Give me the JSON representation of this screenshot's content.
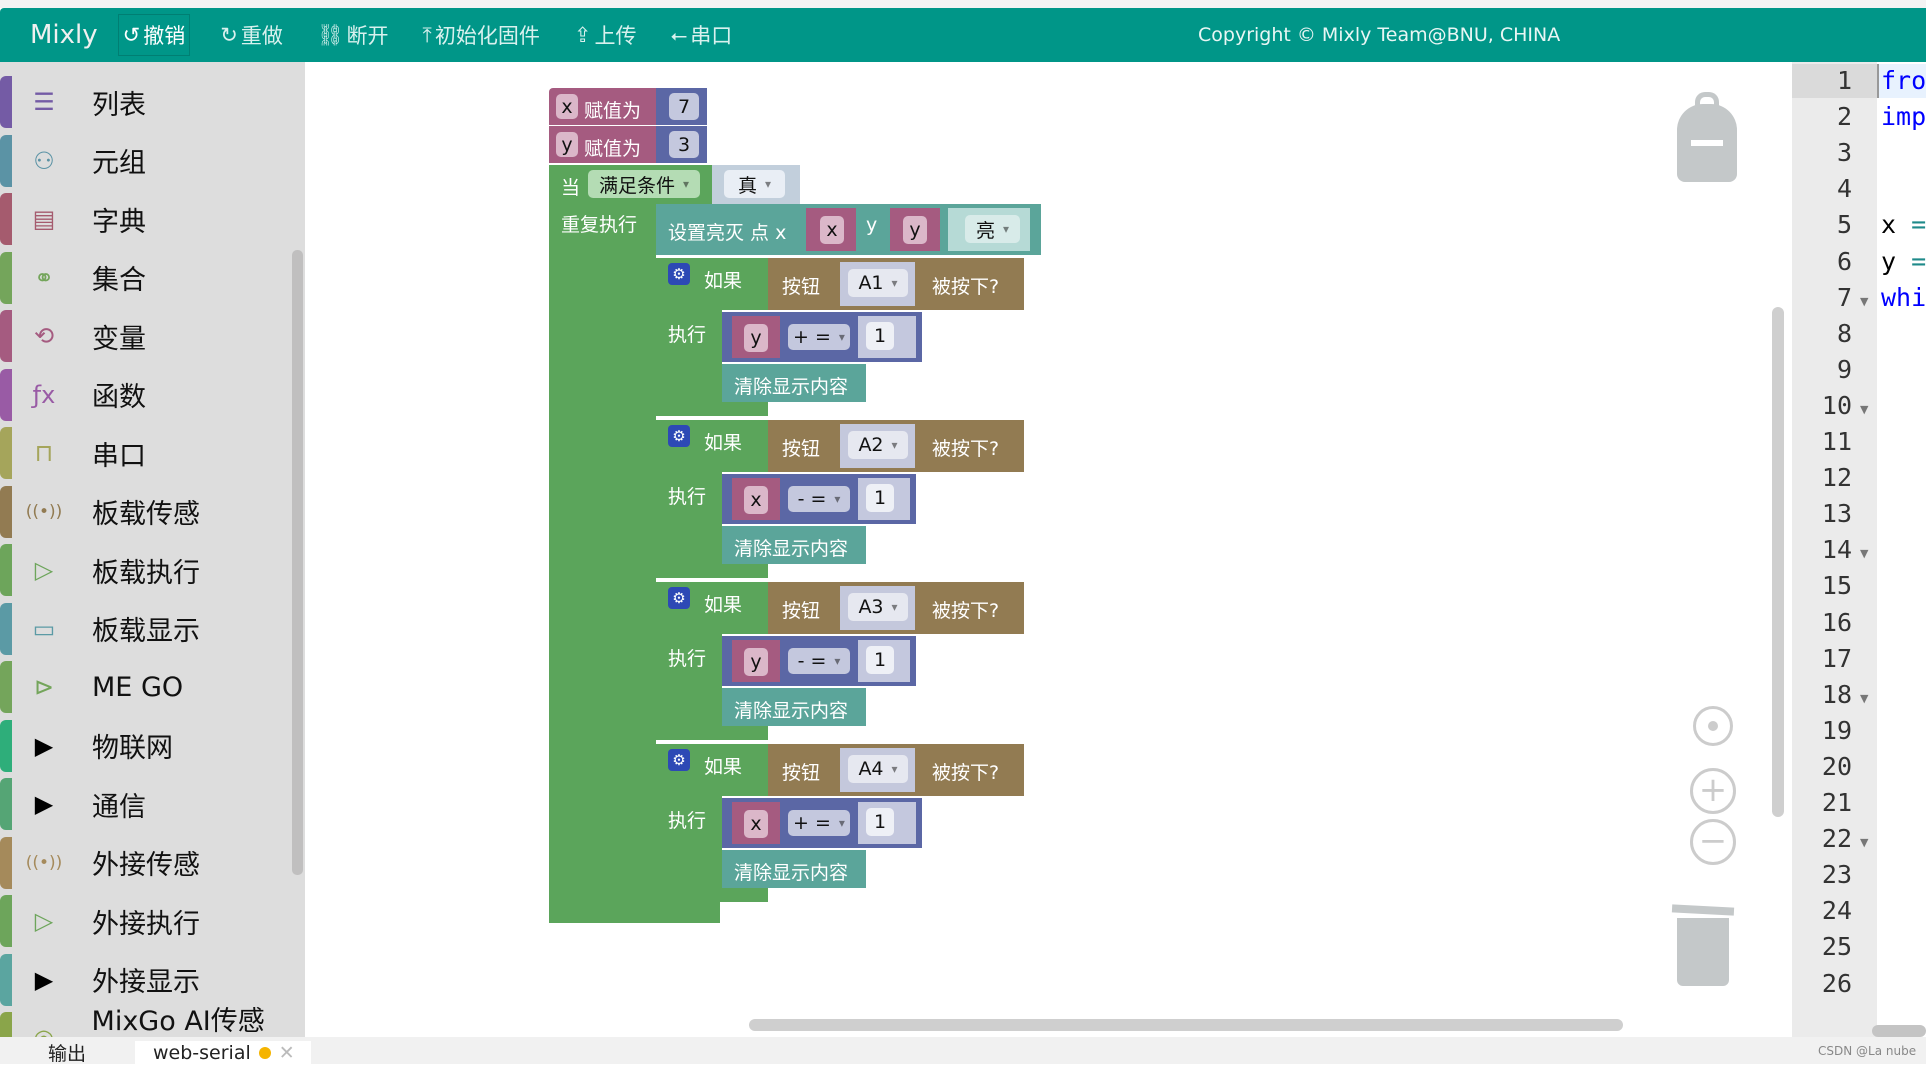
{
  "header": {
    "logo": "Mixly",
    "buttons": [
      {
        "label": "撤销",
        "icon": "undo-icon"
      },
      {
        "label": "重做",
        "icon": "redo-icon"
      },
      {
        "label": "断开",
        "icon": "unlink-icon"
      },
      {
        "label": "初始化固件",
        "icon": "upload-firmware-icon"
      },
      {
        "label": "上传",
        "icon": "upload-icon"
      },
      {
        "label": "串口",
        "icon": "usb-icon"
      }
    ],
    "copyright": "Copyright © Mixly Team@BNU, CHINA"
  },
  "sidebar": {
    "items": [
      {
        "label": "列表",
        "icon": "list-icon",
        "color": "#745ba5",
        "glyph": "☰"
      },
      {
        "label": "元组",
        "icon": "tuple-icon",
        "color": "#5b93a5",
        "glyph": "⚇"
      },
      {
        "label": "字典",
        "icon": "dict-icon",
        "color": "#a55b6e",
        "glyph": "▤"
      },
      {
        "label": "集合",
        "icon": "set-icon",
        "color": "#74a55b",
        "glyph": "⚭"
      },
      {
        "label": "变量",
        "icon": "variable-icon",
        "color": "#a55b80",
        "glyph": "⟲"
      },
      {
        "label": "函数",
        "icon": "function-icon",
        "color": "#995ba5",
        "glyph": "ƒx"
      },
      {
        "label": "串口",
        "icon": "serial-icon",
        "color": "#a5a55b",
        "glyph": "⊓"
      },
      {
        "label": "板载传感",
        "icon": "sensor-icon",
        "color": "#927b52",
        "glyph": "((•))"
      },
      {
        "label": "板载执行",
        "icon": "actuator-icon",
        "color": "#6da55b",
        "glyph": "▷"
      },
      {
        "label": "板载显示",
        "icon": "display-icon",
        "color": "#5b9aa5",
        "glyph": "▭"
      },
      {
        "label": "ME GO",
        "icon": "mego-icon",
        "color": "#74a55b",
        "glyph": "⊳"
      },
      {
        "label": "物联网",
        "icon": "expand-arrow-icon",
        "color": "#2eae7a",
        "glyph": "▶"
      },
      {
        "label": "通信",
        "icon": "expand-arrow-icon",
        "color": "#55a575",
        "glyph": "▶"
      },
      {
        "label": "外接传感",
        "icon": "sensor-icon",
        "color": "#a58a5b",
        "glyph": "((•))"
      },
      {
        "label": "外接执行",
        "icon": "actuator-icon",
        "color": "#6da55b",
        "glyph": "▷"
      },
      {
        "label": "外接显示",
        "icon": "expand-arrow-icon",
        "color": "#5ba5a0",
        "glyph": "▶"
      },
      {
        "label": "MixGo AI传感器",
        "icon": "ai-sensor-icon",
        "color": "#8aa54a",
        "glyph": "◎"
      }
    ]
  },
  "blocks": {
    "assign_x": {
      "var": "x",
      "label": "赋值为",
      "value": "7"
    },
    "assign_y": {
      "var": "y",
      "label": "赋值为",
      "value": "3"
    },
    "while": {
      "label": "当",
      "mode": "满足条件",
      "cond": "真",
      "do": "重复执行"
    },
    "set_led": {
      "label": "设置亮灭 点 x",
      "x": "x",
      "ylabel": "y",
      "y": "y",
      "state": "亮"
    },
    "ifs": [
      {
        "if": "如果",
        "btn": "按钮",
        "pin": "A1",
        "pressed": "被按下?",
        "do": "执行",
        "var": "y",
        "op": "+ =",
        "num": "1",
        "clear": "清除显示内容"
      },
      {
        "if": "如果",
        "btn": "按钮",
        "pin": "A2",
        "pressed": "被按下?",
        "do": "执行",
        "var": "x",
        "op": "- =",
        "num": "1",
        "clear": "清除显示内容"
      },
      {
        "if": "如果",
        "btn": "按钮",
        "pin": "A3",
        "pressed": "被按下?",
        "do": "执行",
        "var": "y",
        "op": "- =",
        "num": "1",
        "clear": "清除显示内容"
      },
      {
        "if": "如果",
        "btn": "按钮",
        "pin": "A4",
        "pressed": "被按下?",
        "do": "执行",
        "var": "x",
        "op": "+ =",
        "num": "1",
        "clear": "清除显示内容"
      }
    ]
  },
  "editor": {
    "lines": [
      "1",
      "2",
      "3",
      "4",
      "5",
      "6",
      "7",
      "8",
      "9",
      "10",
      "11",
      "12",
      "13",
      "14",
      "15",
      "16",
      "17",
      "18",
      "19",
      "20",
      "21",
      "22",
      "23",
      "24",
      "25",
      "26"
    ],
    "code": [
      {
        "kw": "fro"
      },
      {
        "kw": "imp"
      },
      {},
      {},
      {
        "id": "x",
        "op": " ="
      },
      {
        "id": "y",
        "op": " ="
      },
      {
        "kw": "whi"
      }
    ],
    "folds": [
      "7",
      "10",
      "14",
      "18",
      "22"
    ]
  },
  "bottom": {
    "tabs": [
      "输出",
      "web-serial"
    ],
    "watermark": "CSDN @La nube"
  },
  "colors": {
    "accent": "#009688",
    "variable": "#a55b80",
    "math": "#5b67a5",
    "loop": "#5ba55b",
    "display": "#5ba59a",
    "button": "#927b52"
  }
}
